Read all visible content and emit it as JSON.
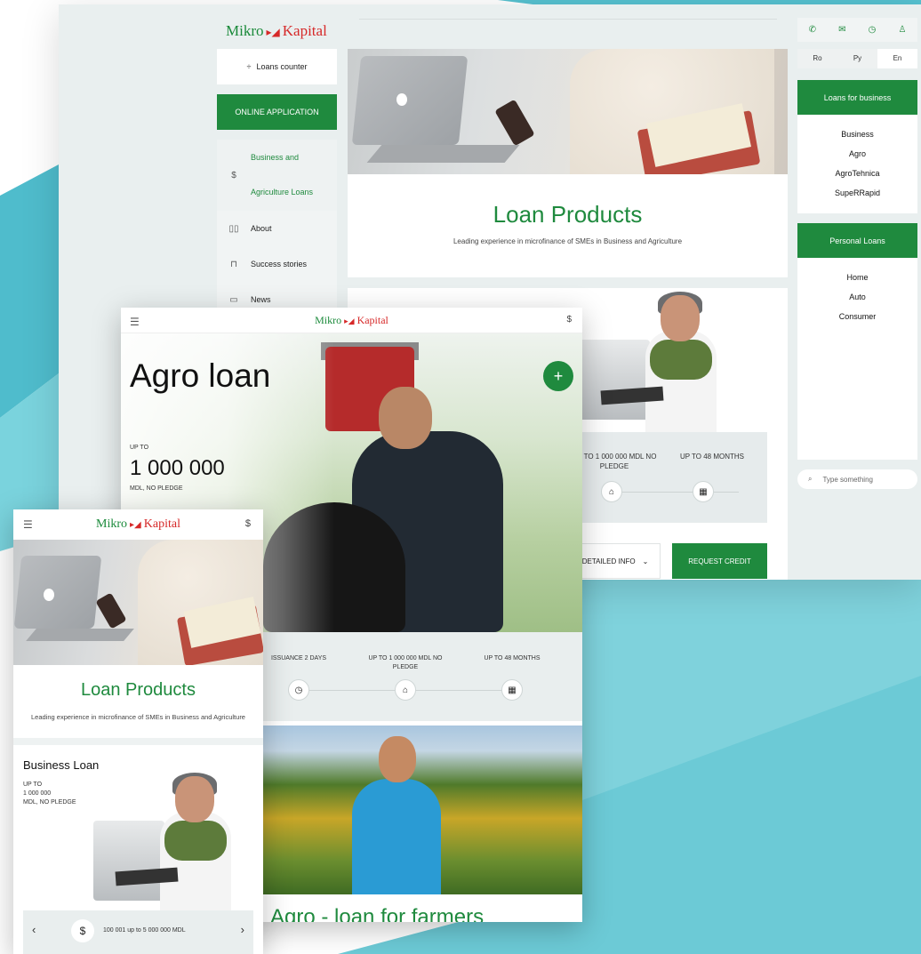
{
  "desktop": {
    "logo": {
      "part1": "Mikro",
      "part2": "Kapital"
    },
    "left_nav": {
      "loans_counter": "Loans counter",
      "online_application": "ONLINE APPLICATION",
      "menu": [
        {
          "label": "Business and Agriculture Loans",
          "active": true
        },
        {
          "label": "About",
          "active": false
        },
        {
          "label": "Success stories",
          "active": false
        },
        {
          "label": "News",
          "active": false
        }
      ]
    },
    "products": {
      "title": "Loan Products",
      "subtitle": "Leading experience in microfinance of SMEs in Business and Agriculture"
    },
    "card": {
      "stat1": "UP TO 1 000 000 MDL NO PLEDGE",
      "stat2": "UP TO 48 MONTHS",
      "detailed_info": "DETAILED INFO",
      "request_credit": "REQUEST CREDIT"
    },
    "right_panel": {
      "languages": [
        "Ro",
        "Ру",
        "En"
      ],
      "active_language": "En",
      "business_head": "Loans for business",
      "business_items": [
        "Business",
        "Agro",
        "AgroTehnica",
        "SupeRRapid"
      ],
      "personal_head": "Personal Loans",
      "personal_items": [
        "Home",
        "Auto",
        "Consumer"
      ],
      "search_placeholder": "Type something"
    }
  },
  "tablet": {
    "logo": {
      "part1": "Mikro",
      "part2": "Kapital"
    },
    "hero": {
      "title": "Agro loan",
      "upto": "UP TO",
      "amount": "1 000 000",
      "unit": "MDL, NO PLEDGE"
    },
    "stats": {
      "issuance": "ISSUANCE 2 DAYS",
      "amount": "UP TO 1 000 000 MDL NO PLEDGE",
      "term": "UP TO 48 MONTHS"
    },
    "bottom_title": "Agro - loan for farmers"
  },
  "phone": {
    "logo": {
      "part1": "Mikro",
      "part2": "Kapital"
    },
    "products": {
      "title": "Loan Products",
      "subtitle": "Leading experience in microfinance of SMEs in Business and Agriculture"
    },
    "card": {
      "title": "Business Loan",
      "line1": "UP TO",
      "line2": "1 000 000",
      "line3": "MDL, NO PLEDGE"
    },
    "slider_text": "100 001 up to 5 000 000 MDL"
  },
  "colors": {
    "brand_green": "#1f8a3e",
    "brand_red": "#d62828",
    "teal_bg": "#5cc6d4"
  }
}
